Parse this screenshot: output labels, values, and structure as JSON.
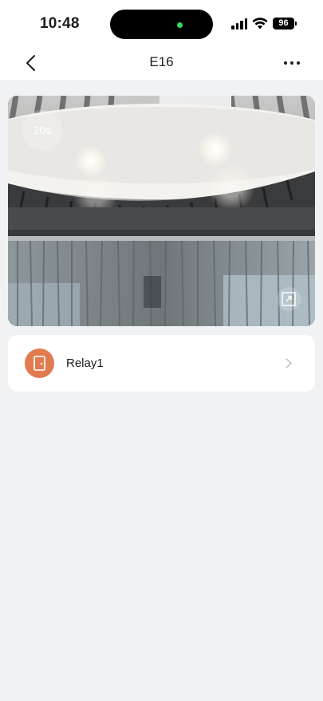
{
  "status_bar": {
    "time": "10:48",
    "battery_level": "96",
    "icons": [
      "signal-icon",
      "wifi-icon",
      "battery-icon"
    ]
  },
  "nav": {
    "title": "E16",
    "back_icon": "chevron-left-icon",
    "more_icon": "more-horizontal-icon"
  },
  "video": {
    "timer_label": "20s",
    "fullscreen_icon": "expand-icon"
  },
  "relays": [
    {
      "label": "Relay1",
      "icon": "door-icon",
      "icon_color": "#e07b4f"
    }
  ],
  "colors": {
    "background": "#f1f2f4",
    "card": "#ffffff",
    "accent": "#e07b4f"
  }
}
